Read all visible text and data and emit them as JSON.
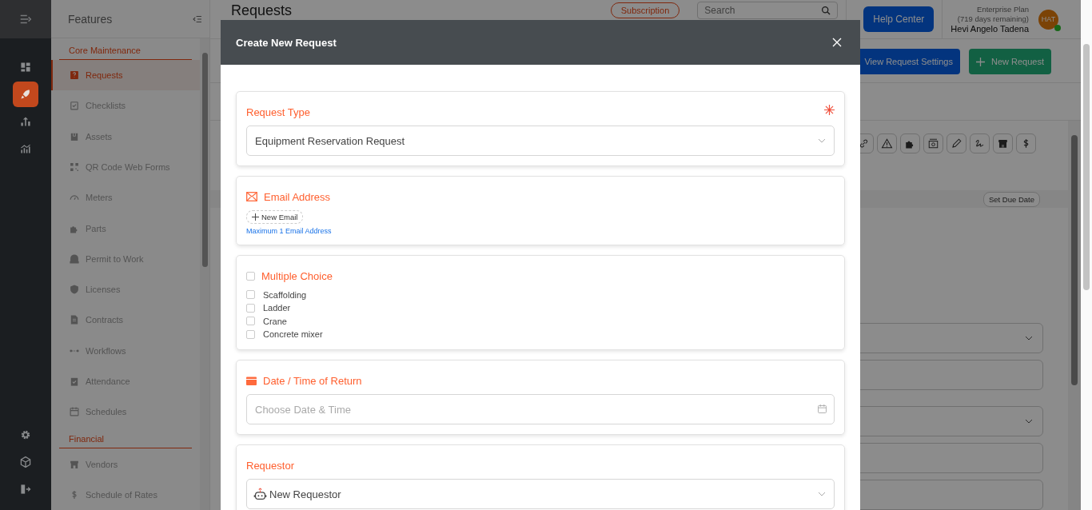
{
  "rail": {
    "items": [
      {
        "selected": false
      },
      {
        "selected": true
      },
      {
        "selected": false
      },
      {
        "selected": false
      }
    ]
  },
  "sidebar": {
    "title": "Features",
    "sections": [
      {
        "heading": "Core Maintenance",
        "items": [
          {
            "label": "Requests",
            "selected": true
          },
          {
            "label": "Checklists",
            "selected": false
          },
          {
            "label": "Assets",
            "selected": false
          },
          {
            "label": "QR Code Web Forms",
            "selected": false
          },
          {
            "label": "Meters",
            "selected": false
          },
          {
            "label": "Parts",
            "selected": false
          },
          {
            "label": "Permit to Work",
            "selected": false
          },
          {
            "label": "Licenses",
            "selected": false
          },
          {
            "label": "Contracts",
            "selected": false
          },
          {
            "label": "Workflows",
            "selected": false
          },
          {
            "label": "Attendance",
            "selected": false
          },
          {
            "label": "Schedules",
            "selected": false
          }
        ]
      },
      {
        "heading": "Financial",
        "items": [
          {
            "label": "Vendors",
            "selected": false
          },
          {
            "label": "Schedule of Rates",
            "selected": false
          }
        ]
      }
    ]
  },
  "header": {
    "title": "Requests",
    "subscription": "Subscription",
    "search": {
      "placeholder": "Search"
    },
    "help": "Help Center",
    "plan": "Enterprise Plan",
    "remaining": "(719 days remaining)",
    "user": "Hevi Angelo Tadena",
    "avatar": "HAT",
    "online": true
  },
  "actions": [
    "View Request Settings",
    "New Request"
  ],
  "due_date_button": "Set Due Date",
  "modal": {
    "title": "Create New Request",
    "fields": [
      {
        "kind": "select",
        "label": "Request Type",
        "required": true,
        "value": "Equipment Reservation Request"
      },
      {
        "kind": "email",
        "label": "Email Address",
        "button": "New Email",
        "hint": "Maximum 1 Email Address"
      },
      {
        "kind": "choices",
        "label": "Multiple Choice",
        "checked": false,
        "options": [
          {
            "label": "Scaffolding",
            "checked": false
          },
          {
            "label": "Ladder",
            "checked": false
          },
          {
            "label": "Crane",
            "checked": false
          },
          {
            "label": "Concrete mixer",
            "checked": false
          }
        ]
      },
      {
        "kind": "datetime",
        "label": "Date / Time of Return",
        "placeholder": "Choose Date & Time"
      },
      {
        "kind": "person_select",
        "label": "Requestor",
        "value": "New Requestor"
      }
    ]
  }
}
